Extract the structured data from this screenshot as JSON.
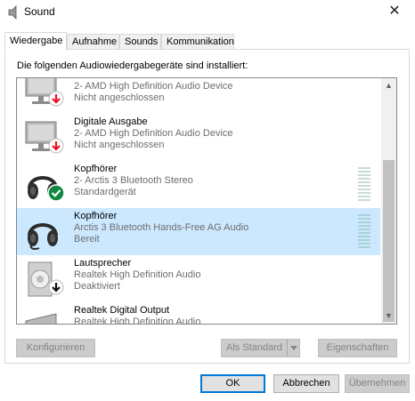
{
  "window": {
    "title": "Sound",
    "close_glyph": "✕"
  },
  "tabs": [
    {
      "label": "Wiedergabe",
      "active": true
    },
    {
      "label": "Aufnahme",
      "active": false
    },
    {
      "label": "Sounds",
      "active": false
    },
    {
      "label": "Kommunikation",
      "active": false
    }
  ],
  "instruction": "Die folgenden Audiowiedergabegeräte sind installiert:",
  "devices": [
    {
      "name": "",
      "line1": "2- AMD High Definition Audio Device",
      "line2": "Nicht angeschlossen",
      "icon": "monitor-icon",
      "status_icon": "down-arrow-red-icon",
      "selected": false
    },
    {
      "name": "Digitale Ausgabe",
      "line1": "2- AMD High Definition Audio Device",
      "line2": "Nicht angeschlossen",
      "icon": "monitor-icon",
      "status_icon": "down-arrow-red-icon",
      "selected": false
    },
    {
      "name": "Kopfhörer",
      "line1": "2- Arctis 3 Bluetooth Stereo",
      "line2": "Standardgerät",
      "icon": "headphones-icon",
      "status_icon": "checkmark-green-icon",
      "selected": false
    },
    {
      "name": "Kopfhörer",
      "line1": "Arctis 3 Bluetooth Hands-Free AG Audio",
      "line2": "Bereit",
      "icon": "headphones-icon",
      "status_icon": "",
      "selected": true
    },
    {
      "name": "Lautsprecher",
      "line1": "Realtek High Definition Audio",
      "line2": "Deaktiviert",
      "icon": "speaker-icon",
      "status_icon": "down-arrow-black-icon",
      "selected": false
    },
    {
      "name": "Realtek Digital Output",
      "line1": "Realtek High Definition Audio",
      "line2": "",
      "icon": "monitor-icon",
      "status_icon": "",
      "selected": false
    }
  ],
  "buttons": {
    "configure": "Konfigurieren",
    "set_default": "Als Standard",
    "properties": "Eigenschaften",
    "ok": "OK",
    "cancel": "Abbrechen",
    "apply": "Übernehmen"
  },
  "colors": {
    "selection": "#cce8ff",
    "accent": "#0078d7",
    "error": "#e81123",
    "ok": "#107c10"
  }
}
